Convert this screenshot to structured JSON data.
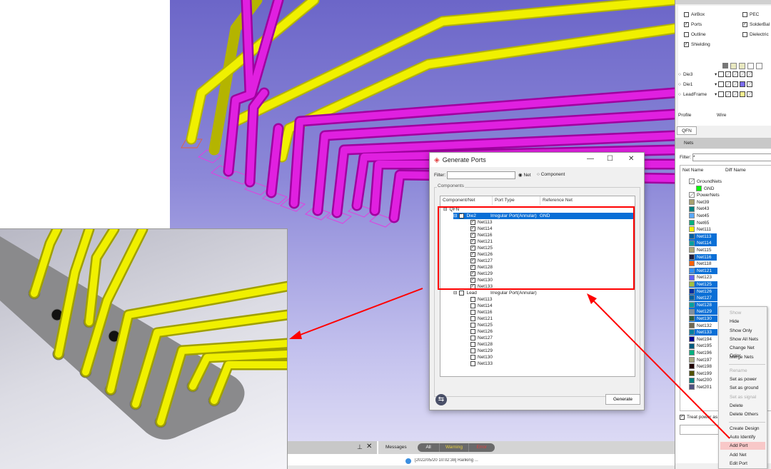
{
  "dialog": {
    "title": "Generate Ports",
    "filter_label": "Filter:",
    "filter_value": "",
    "radio_net": "Net",
    "radio_component": "Component",
    "group_label": "Components",
    "columns": [
      "Component/Net",
      "Port Type",
      "Reference Net"
    ],
    "root": "QFN",
    "components": [
      {
        "name": "Die2",
        "checked": true,
        "selected": true,
        "port_type": "Irregular Port(Annular)",
        "reference_net": "GND",
        "nets": [
          "Net113",
          "Net114",
          "Net116",
          "Net121",
          "Net125",
          "Net126",
          "Net127",
          "Net128",
          "Net129",
          "Net130",
          "Net133"
        ]
      },
      {
        "name": "Lead",
        "checked": false,
        "selected": false,
        "port_type": "Irregular Port(Annular)",
        "reference_net": "",
        "nets": [
          "Net113",
          "Net114",
          "Net116",
          "Net121",
          "Net125",
          "Net126",
          "Net127",
          "Net128",
          "Net129",
          "Net130",
          "Net133"
        ]
      }
    ],
    "generate_label": "Generate"
  },
  "layers_panel": {
    "checkboxes": [
      {
        "label": "AirBox",
        "checked": false
      },
      {
        "label": "PEC",
        "checked": false
      },
      {
        "label": "Ports",
        "checked": true
      },
      {
        "label": "SolderBal",
        "checked": true
      },
      {
        "label": "Outline",
        "checked": false
      },
      {
        "label": "Dielectric",
        "checked": false
      },
      {
        "label": "Shielding",
        "checked": true
      }
    ],
    "layers": [
      {
        "name": "Die3",
        "color": ""
      },
      {
        "name": "Die1",
        "color": "#7b6cf0"
      },
      {
        "name": "LeadFrame",
        "color": "#f8f090"
      }
    ],
    "profile_label": "Profile",
    "wire_label": "Wire",
    "tab": "QFN"
  },
  "nets_panel": {
    "title": "Nets",
    "filter_label": "Filter:",
    "filter_value": "*",
    "col_net": "Net Name",
    "col_diff": "Diff Name",
    "items": [
      {
        "name": "GroundNets",
        "color": "hatch",
        "level": 1,
        "selected": false
      },
      {
        "name": "GND",
        "color": "#00ff00",
        "level": 2,
        "selected": false
      },
      {
        "name": "PowerNets",
        "color": "hatch",
        "level": 1,
        "selected": false
      },
      {
        "name": "Net39",
        "color": "#a8a070",
        "level": 1,
        "selected": false
      },
      {
        "name": "Net43",
        "color": "#008080",
        "level": 1,
        "selected": false
      },
      {
        "name": "Net45",
        "color": "#5aa8ff",
        "level": 1,
        "selected": false
      },
      {
        "name": "Net65",
        "color": "#00b080",
        "level": 1,
        "selected": false
      },
      {
        "name": "Net111",
        "color": "#f0f000",
        "level": 1,
        "selected": false
      },
      {
        "name": "Net113",
        "color": "#0060a0",
        "level": 1,
        "selected": true
      },
      {
        "name": "Net114",
        "color": "#00a0a0",
        "level": 1,
        "selected": true
      },
      {
        "name": "Net115",
        "color": "#b0a878",
        "level": 1,
        "selected": false
      },
      {
        "name": "Net116",
        "color": "#202040",
        "level": 1,
        "selected": true
      },
      {
        "name": "Net118",
        "color": "#ff6000",
        "level": 1,
        "selected": false
      },
      {
        "name": "Net121",
        "color": "#3090ff",
        "level": 1,
        "selected": true
      },
      {
        "name": "Net123",
        "color": "#6060ff",
        "level": 1,
        "selected": false
      },
      {
        "name": "Net125",
        "color": "#a0c040",
        "level": 1,
        "selected": true
      },
      {
        "name": "Net126",
        "color": "#0030a0",
        "level": 1,
        "selected": true
      },
      {
        "name": "Net127",
        "color": "#0060a0",
        "level": 1,
        "selected": true
      },
      {
        "name": "Net128",
        "color": "#00a0a0",
        "level": 1,
        "selected": true
      },
      {
        "name": "Net129",
        "color": "#8090a0",
        "level": 1,
        "selected": true
      },
      {
        "name": "Net130",
        "color": "#306040",
        "level": 1,
        "selected": true
      },
      {
        "name": "Net132",
        "color": "#706850",
        "level": 1,
        "selected": false
      },
      {
        "name": "Net133",
        "color": "#0080a0",
        "level": 1,
        "selected": true
      },
      {
        "name": "Net194",
        "color": "#000090",
        "level": 1,
        "selected": false
      },
      {
        "name": "Net195",
        "color": "#005a80",
        "level": 1,
        "selected": false
      },
      {
        "name": "Net196",
        "color": "#00b080",
        "level": 1,
        "selected": false
      },
      {
        "name": "Net197",
        "color": "#a8a880",
        "level": 1,
        "selected": false
      },
      {
        "name": "Net198",
        "color": "#200000",
        "level": 1,
        "selected": false
      },
      {
        "name": "Net199",
        "color": "#505000",
        "level": 1,
        "selected": false
      },
      {
        "name": "Net200",
        "color": "#008080",
        "level": 1,
        "selected": false
      },
      {
        "name": "Net201",
        "color": "#505080",
        "level": 1,
        "selected": false
      }
    ],
    "treat_power_label": "Treat power as g",
    "treat_power_checked": true
  },
  "context_menu": {
    "items": [
      {
        "label": "Show",
        "disabled": true
      },
      {
        "label": "Hide"
      },
      {
        "label": "Show Only"
      },
      {
        "label": "Show All Nets"
      },
      {
        "label": "Change Net Color"
      },
      {
        "label": "Merge Nets"
      },
      {
        "sep": true
      },
      {
        "label": "Rename",
        "disabled": true
      },
      {
        "label": "Set as power"
      },
      {
        "label": "Set as ground"
      },
      {
        "label": "Set as signal",
        "disabled": true
      },
      {
        "label": "Delete"
      },
      {
        "label": "Delete Others"
      },
      {
        "sep": true
      },
      {
        "label": "Create Design"
      },
      {
        "label": "Auto Identify Nets"
      },
      {
        "label": "Add Port",
        "highlighted": true
      },
      {
        "label": "Add Net"
      },
      {
        "label": "Edit Port"
      }
    ]
  },
  "messages": {
    "title": "Messages",
    "filters": [
      "All",
      "Warning",
      "Error"
    ],
    "line": "[2022/05/20 10:02:38] Ranking ..."
  },
  "colors": {
    "annotation": "#ff0000",
    "selection": "#0a6fd6",
    "pin": "#f0f000",
    "wire": "#d000d0"
  }
}
